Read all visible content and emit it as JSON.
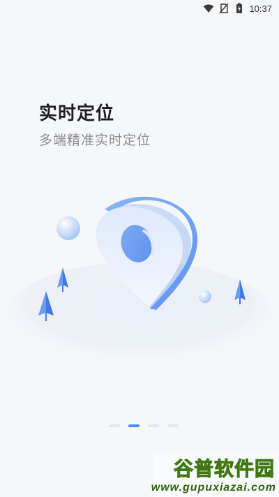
{
  "status_bar": {
    "time": "10:37",
    "icons": [
      "wifi-icon",
      "no-sim-icon",
      "battery-charging-icon"
    ]
  },
  "intro": {
    "title": "实时定位",
    "subtitle": "多端精准实时定位"
  },
  "illustration": {
    "name": "location-pin-illustration",
    "accent_color": "#4d8cf0",
    "light_color": "#dce7f7"
  },
  "pager": {
    "total_pages": 4,
    "active_page": 2
  },
  "watermark": {
    "logo_text": "谷普软件园",
    "url": "www.gupuxiazai.com",
    "color": "#5a9b1a"
  }
}
